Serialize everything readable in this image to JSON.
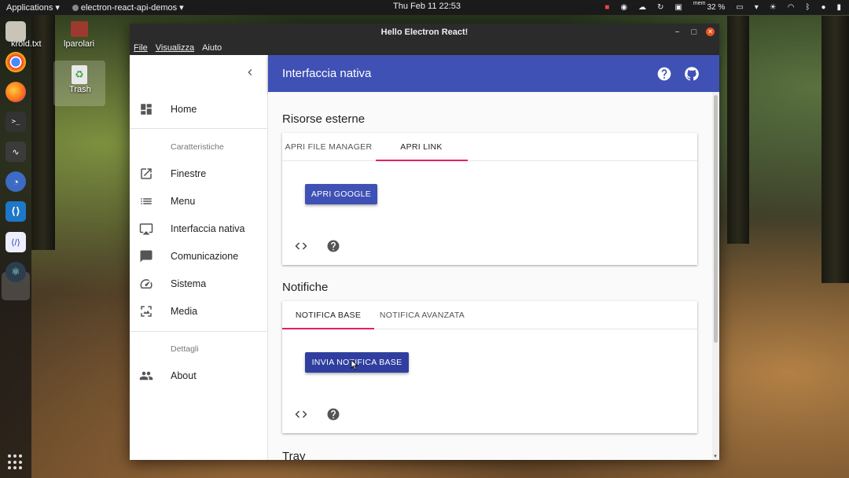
{
  "topbar": {
    "applications_label": "Applications",
    "active_app_label": "electron-react-api-demos",
    "clock": "Thu Feb 11  22:53",
    "mem_label": "mem",
    "mem_value": "32 %"
  },
  "desktop": {
    "icons": [
      {
        "label": "krold.txt"
      },
      {
        "label": "lparolari"
      },
      {
        "label": "Trash"
      }
    ]
  },
  "window": {
    "title": "Hello Electron React!",
    "menu": [
      "File",
      "Visualizza",
      "Aiuto"
    ]
  },
  "sidebar": {
    "items_top": [
      {
        "label": "Home",
        "icon": "dashboard-icon"
      }
    ],
    "section1_label": "Caratteristiche",
    "items_main": [
      {
        "label": "Finestre",
        "icon": "open-in-new-icon"
      },
      {
        "label": "Menu",
        "icon": "list-icon"
      },
      {
        "label": "Interfaccia nativa",
        "icon": "airplay-icon"
      },
      {
        "label": "Comunicazione",
        "icon": "chat-icon"
      },
      {
        "label": "Sistema",
        "icon": "speedometer-icon"
      },
      {
        "label": "Media",
        "icon": "image-frame-icon"
      }
    ],
    "section2_label": "Dettagli",
    "items_bottom": [
      {
        "label": "About",
        "icon": "people-icon"
      }
    ]
  },
  "appbar": {
    "title": "Interfaccia nativa",
    "help_icon": "help-icon",
    "github_icon": "github-icon",
    "color": "#3f51b5"
  },
  "sections": [
    {
      "heading": "Risorse esterne",
      "tabs": [
        "APRI FILE MANAGER",
        "APRI LINK"
      ],
      "active_tab": 1,
      "button_label": "APRI GOOGLE"
    },
    {
      "heading": "Notifiche",
      "tabs": [
        "NOTIFICA BASE",
        "NOTIFICA AVANZATA"
      ],
      "active_tab": 0,
      "button_label": "INVIA NOTIFICA BASE"
    },
    {
      "heading": "Tray"
    }
  ],
  "colors": {
    "primary": "#3f51b5",
    "tab_indicator": "#e91e63"
  }
}
